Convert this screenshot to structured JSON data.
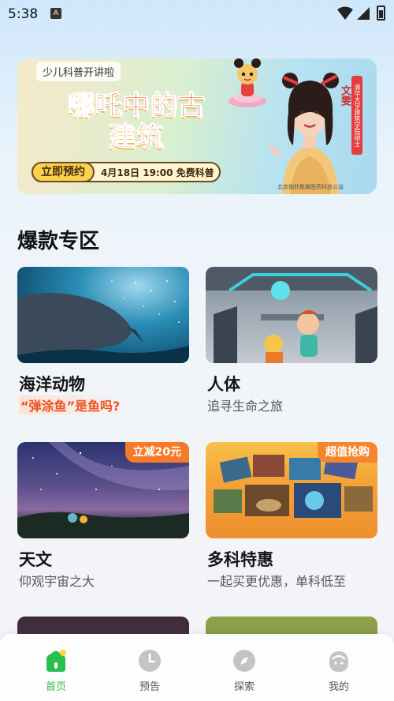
{
  "status_bar": {
    "time": "5:38",
    "notification_icon": "a-letter-icon"
  },
  "banner": {
    "tag": "少儿科普开讲啦",
    "title": "哪吒中的古建筑",
    "cta_button": "立即预约",
    "cta_text": "4月18日 19:00 免费科普",
    "presenter_name": "文雯",
    "ribbon": "清华大学建筑学院硕士",
    "footnote": "北京抱朴数媒医药科技公益"
  },
  "section": {
    "title": "爆款专区"
  },
  "cards": [
    {
      "title": "海洋动物",
      "subtitle": "“弹涂鱼”是鱼吗?",
      "badge": ""
    },
    {
      "title": "人体",
      "subtitle": "追寻生命之旅",
      "badge": ""
    },
    {
      "title": "天文",
      "subtitle": "仰观宇宙之大",
      "badge": "立减20元"
    },
    {
      "title": "多科特惠",
      "subtitle": "一起买更优惠，单科低至",
      "badge": "超值抢购"
    }
  ],
  "tabs": [
    {
      "label": "首页",
      "icon": "home-icon",
      "active": true
    },
    {
      "label": "预告",
      "icon": "clock-icon",
      "active": false
    },
    {
      "label": "探索",
      "icon": "compass-icon",
      "active": false
    },
    {
      "label": "我的",
      "icon": "profile-icon",
      "active": false
    }
  ],
  "colors": {
    "accent_green": "#2bbf4e",
    "accent_orange": "#f0501e",
    "badge_orange": "#f57a2a"
  }
}
